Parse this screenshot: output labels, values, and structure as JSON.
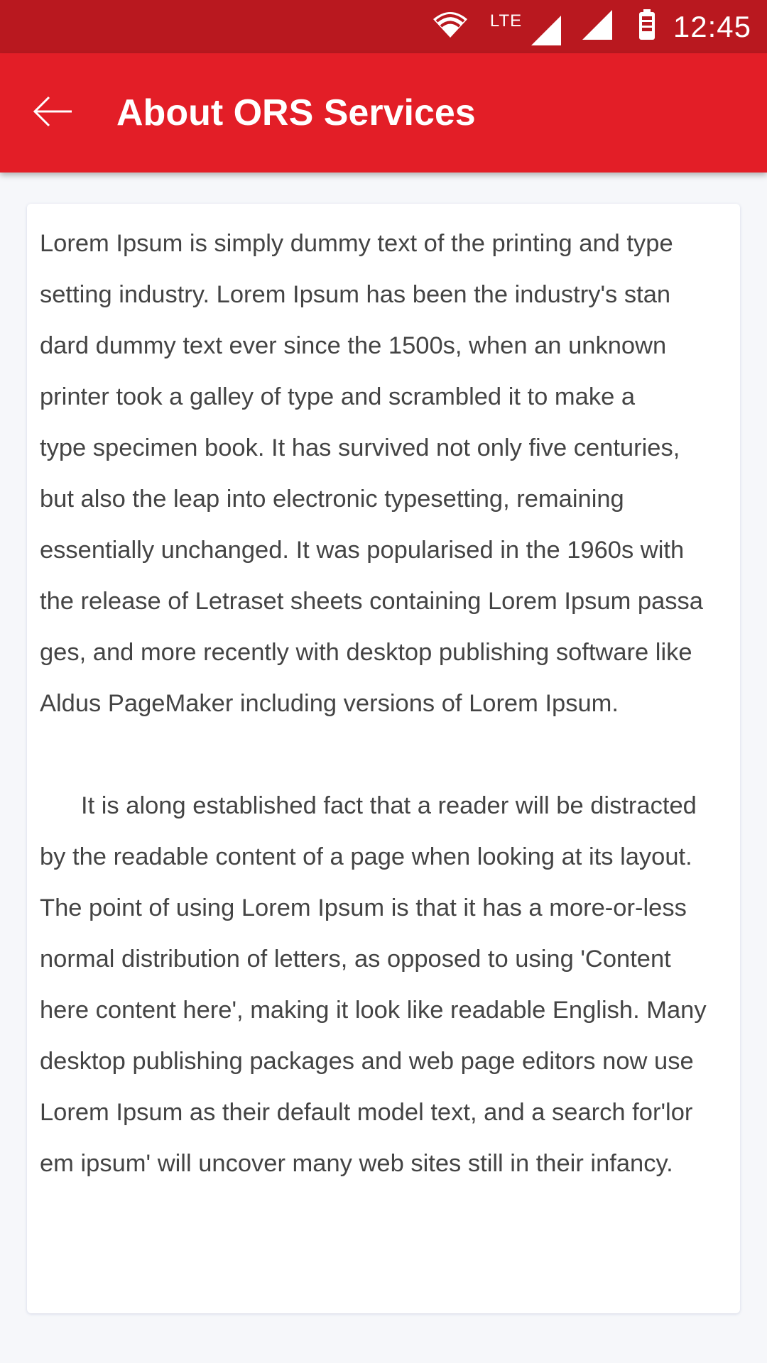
{
  "status_bar": {
    "network_label": "LTE",
    "time": "12:45",
    "icons": [
      "wifi-icon",
      "signal-icon",
      "signal-icon",
      "battery-icon"
    ]
  },
  "app_bar": {
    "back_icon": "arrow-left-icon",
    "title": "About ORS Services"
  },
  "content": {
    "paragraph1": [
      "Lorem Ipsum is simply dummy text of the printing and type",
      "setting industry. Lorem Ipsum has been the industry's stan",
      "dard dummy text ever since the 1500s, when an unknown",
      "printer took a galley of type and scrambled it to make a",
      "type specimen book. It has survived not only five centuries,",
      "but also the leap into electronic typesetting, remaining",
      "essentially unchanged. It was popularised in the 1960s with",
      "the release of Letraset sheets containing Lorem Ipsum passa",
      "ges, and more recently with desktop publishing software like",
      "Aldus PageMaker including versions of Lorem Ipsum."
    ],
    "paragraph2": [
      "It is along established fact that a reader will be distracted",
      "by the readable content of a page when looking at its layout.",
      "The point of using Lorem Ipsum is that it has a more-or-less",
      "normal distribution of letters, as opposed to using 'Content",
      "here content here', making it look like readable English. Many",
      "desktop publishing packages and web page editors now use",
      "Lorem Ipsum as their default model text, and a search for'lor",
      "em ipsum' will uncover many web sites still in their infancy."
    ]
  },
  "colors": {
    "status_bar": "#b9181f",
    "app_bar": "#e31e27",
    "background": "#f6f7fa",
    "card": "#ffffff",
    "text": "#444444"
  }
}
